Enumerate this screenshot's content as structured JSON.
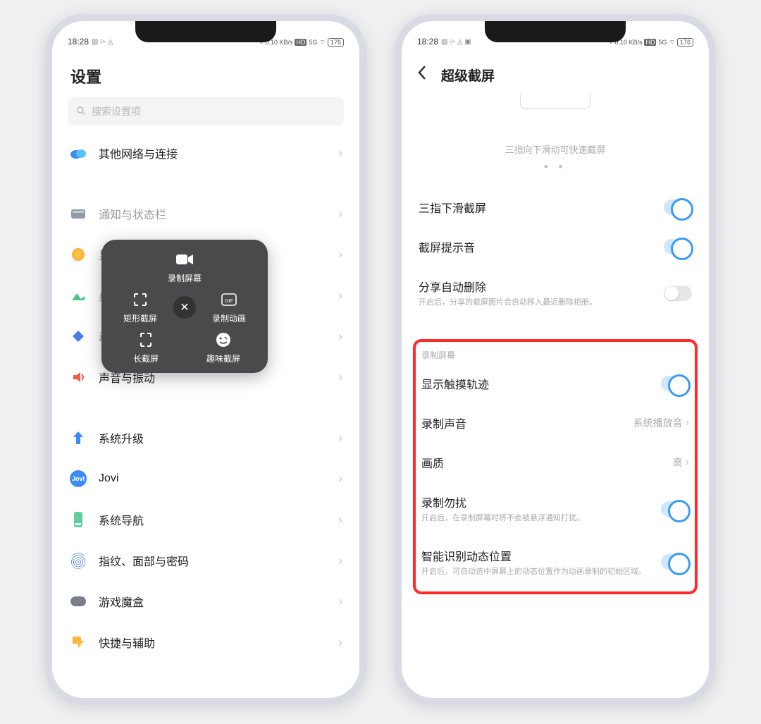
{
  "status": {
    "time": "18:28",
    "net_speed": "0.10 KB/s",
    "network": "5G",
    "battery": "176"
  },
  "left": {
    "title": "设置",
    "search_placeholder": "搜索设置项",
    "items": [
      {
        "label": "其他网络与连接",
        "icon": "cloud"
      },
      {
        "label": "通知与状态栏",
        "icon": "status"
      },
      {
        "label": "显示与亮度",
        "icon": "sun"
      },
      {
        "label": "桌面、锁屏与壁纸",
        "icon": "image"
      },
      {
        "label": "动态效果",
        "icon": "diamond"
      },
      {
        "label": "声音与振动",
        "icon": "speaker"
      },
      {
        "label": "系统升级",
        "icon": "up"
      },
      {
        "label": "Jovi",
        "icon": "jovi"
      },
      {
        "label": "系统导航",
        "icon": "nav"
      },
      {
        "label": "指纹、面部与密码",
        "icon": "finger"
      },
      {
        "label": "游戏魔盒",
        "icon": "game"
      },
      {
        "label": "快捷与辅助",
        "icon": "access"
      }
    ],
    "popup": {
      "record": "录制屏幕",
      "rect": "矩形截屏",
      "gif": "录制动画",
      "long": "长截屏",
      "fun": "趣味截屏"
    }
  },
  "right": {
    "title": "超级截屏",
    "hint": "三指向下滑动可快速截屏",
    "rows": {
      "three_finger": {
        "label": "三指下滑截屏"
      },
      "sound": {
        "label": "截屏提示音"
      },
      "auto_delete": {
        "label": "分享自动删除",
        "sub": "开启后，分享的截屏图片会自动移入最近删除相册。"
      }
    },
    "section": "录制屏幕",
    "rec_rows": {
      "touch": {
        "label": "显示触摸轨迹"
      },
      "audio": {
        "label": "录制声音",
        "value": "系统播放音"
      },
      "quality": {
        "label": "画质",
        "value": "高"
      },
      "dnd": {
        "label": "录制勿扰",
        "sub": "开启后，在录制屏幕时将不会被悬浮通知打扰。"
      },
      "smart": {
        "label": "智能识别动态位置",
        "sub": "开启后，可自动选中屏幕上的动态位置作为动画录制的初始区域。"
      }
    }
  }
}
